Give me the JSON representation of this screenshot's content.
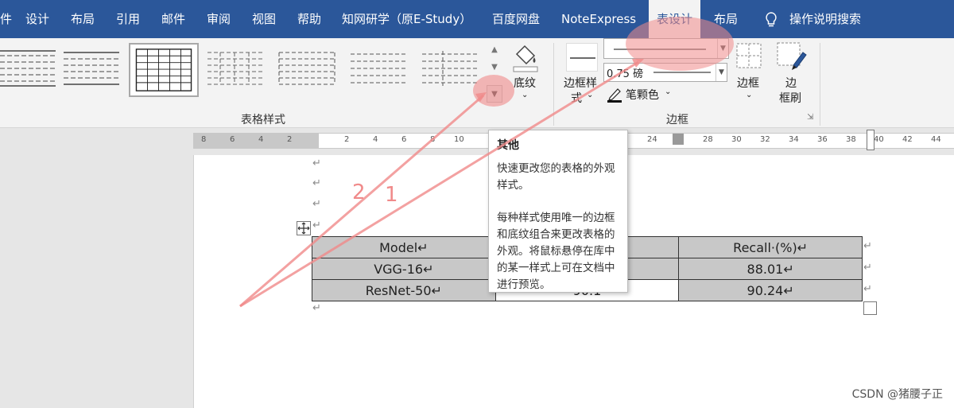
{
  "tabs": [
    {
      "label": "件"
    },
    {
      "label": "设计"
    },
    {
      "label": "布局"
    },
    {
      "label": "引用"
    },
    {
      "label": "邮件"
    },
    {
      "label": "审阅"
    },
    {
      "label": "视图"
    },
    {
      "label": "帮助"
    },
    {
      "label": "知网研学（原E-Study）"
    },
    {
      "label": "百度网盘"
    },
    {
      "label": "NoteExpress"
    },
    {
      "label": "表设计"
    },
    {
      "label": "布局"
    },
    {
      "label": "操作说明搜索"
    }
  ],
  "ribbon": {
    "table_styles_label": "表格样式",
    "shading_label": "底纹",
    "border_styles_label_1": "边框样",
    "border_styles_label_2": "式",
    "pen_weight": "0.75 磅",
    "pen_color_label": "笔颗色",
    "borders_label": "边框",
    "border_painter_label_1": "边",
    "border_painter_label_2": "框刷",
    "borders_group_label": "边框"
  },
  "ruler": {
    "left_numbers": [
      "8",
      "6",
      "4",
      "2"
    ],
    "right_numbers": [
      "2",
      "4",
      "6",
      "8",
      "10"
    ],
    "far_numbers": [
      "24",
      "28",
      "30",
      "32",
      "34",
      "36",
      "38",
      "40",
      "42",
      "44"
    ]
  },
  "table": {
    "rows": [
      [
        "Model↵",
        "",
        "Recall·(%)↵"
      ],
      [
        "VGG-16↵",
        "",
        "88.01↵"
      ],
      [
        "ResNet-50↵",
        "90.1",
        "90.24↵"
      ]
    ]
  },
  "tooltip": {
    "title": "其他",
    "para1": "快速更改您的表格的外观样式。",
    "para2": "每种样式使用唯一的边框和底纹组合来更改表格的外观。将鼠标悬停在库中的某一样式上可在文档中进行预览。"
  },
  "annotations": {
    "label_2": "2",
    "label_1": "1"
  },
  "watermark": "CSDN @猪腰子正",
  "paragraph_mark": "↵",
  "colors": {
    "ribbon_blue": "#2b579a",
    "annotation": "#f08a8a"
  }
}
